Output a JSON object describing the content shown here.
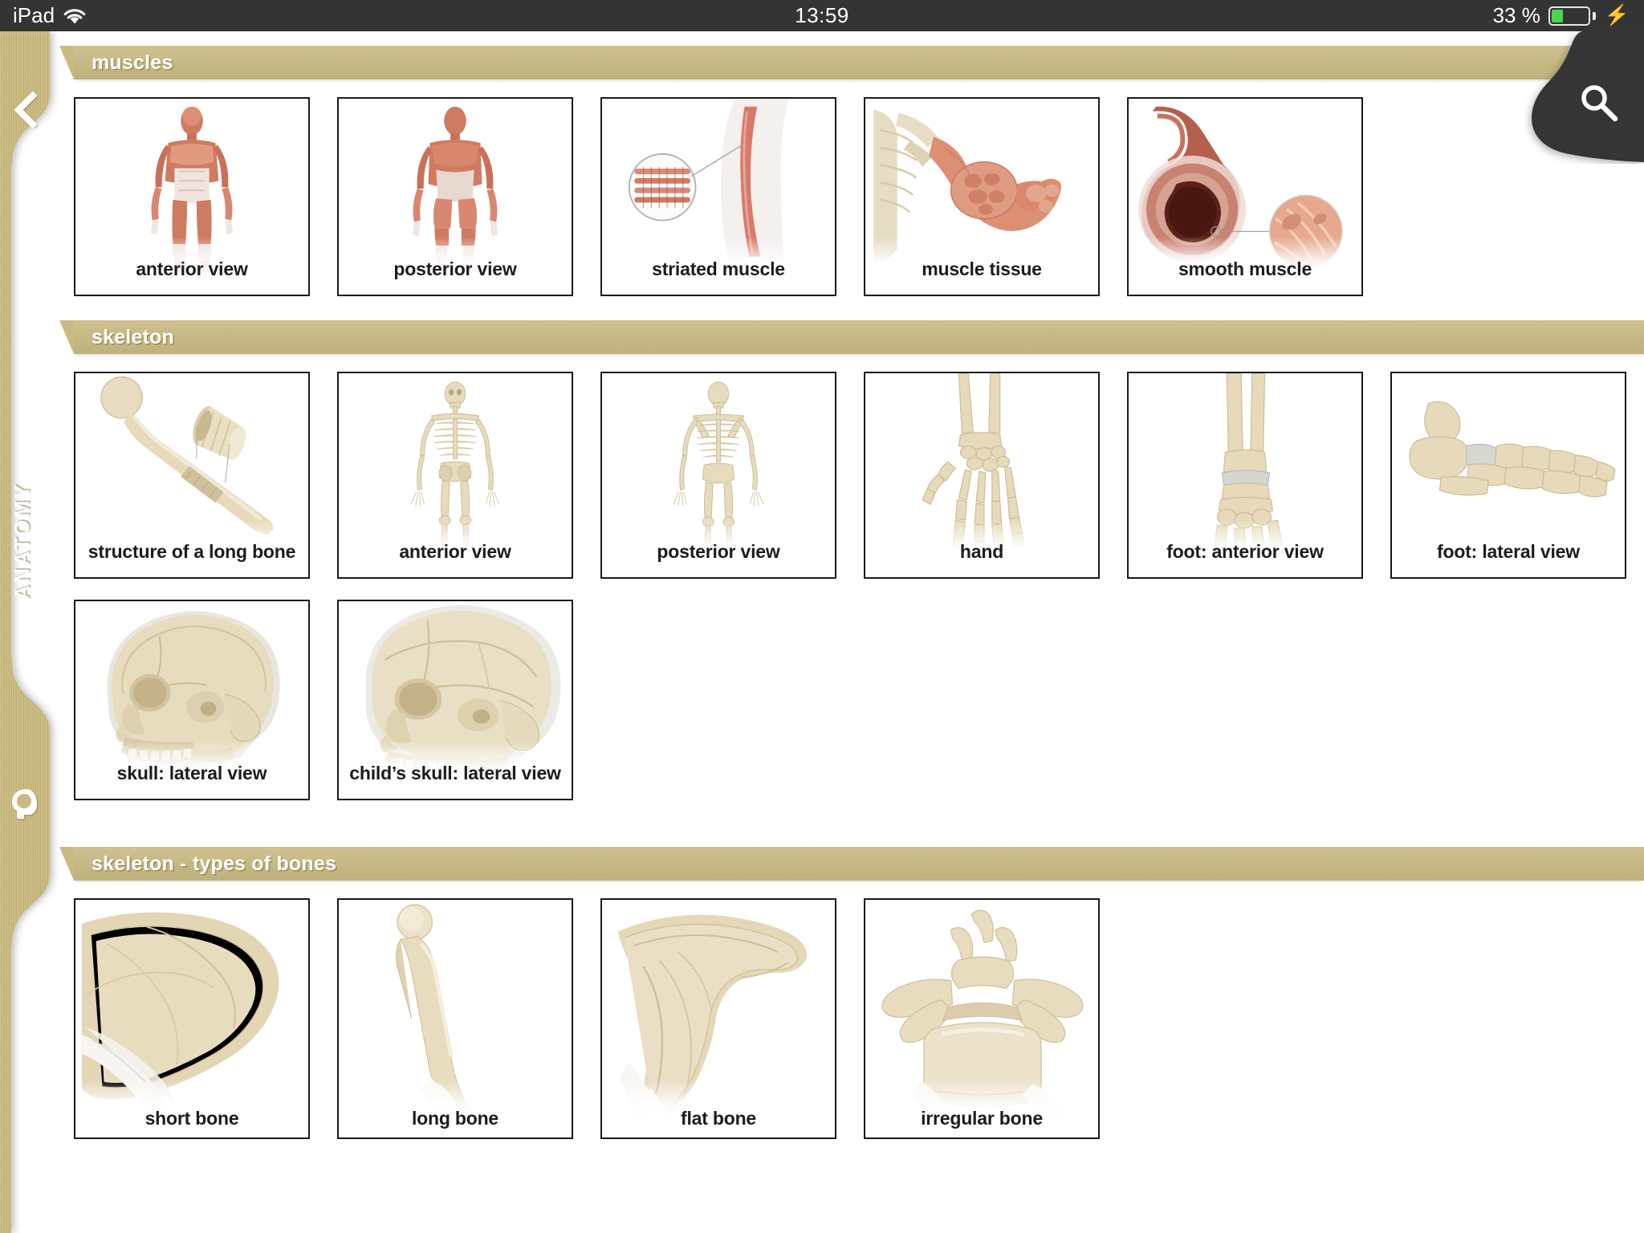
{
  "status_bar": {
    "device": "iPad",
    "wifi_icon": "wifi-icon",
    "time": "13:59",
    "battery_percent": "33 %",
    "battery_level": 33,
    "battery_color": "#4cd54c",
    "charging_icon": "lightning-bolt-icon"
  },
  "sidebar": {
    "title": "ANATOMY",
    "back_icon": "back-chevron-icon",
    "head_icon": "head-brain-icon",
    "color": "#c9ba81"
  },
  "search": {
    "icon": "search-icon",
    "tab_color": "#343434"
  },
  "theme": {
    "band_color": "#c9ba81",
    "card_border": "#1a1a1a",
    "label_color": "#1c1c1c",
    "page_background": "#ffffff"
  },
  "sections": [
    {
      "id": "muscles",
      "title": "muscles",
      "cards": [
        {
          "label": "anterior view",
          "art": "muscular-system-anterior"
        },
        {
          "label": "posterior view",
          "art": "muscular-system-posterior"
        },
        {
          "label": "striated muscle",
          "art": "striated-muscle"
        },
        {
          "label": "muscle tissue",
          "art": "muscle-tissue"
        },
        {
          "label": "smooth muscle",
          "art": "smooth-muscle"
        }
      ]
    },
    {
      "id": "skeleton",
      "title": "skeleton",
      "cards": [
        {
          "label": "structure of a long bone",
          "art": "long-bone-structure"
        },
        {
          "label": "anterior view",
          "art": "skeleton-anterior"
        },
        {
          "label": "posterior view",
          "art": "skeleton-posterior"
        },
        {
          "label": "hand",
          "art": "hand-bones"
        },
        {
          "label": "foot: anterior view",
          "art": "foot-anterior"
        },
        {
          "label": "foot: lateral view",
          "art": "foot-lateral"
        },
        {
          "label": "skull: lateral view",
          "art": "skull-lateral"
        },
        {
          "label": "child’s skull: lateral view",
          "art": "child-skull-lateral"
        }
      ]
    },
    {
      "id": "skeleton-types-of-bones",
      "title": "skeleton - types of bones",
      "cards": [
        {
          "label": "short bone",
          "art": "short-bone"
        },
        {
          "label": "long bone",
          "art": "long-bone"
        },
        {
          "label": "flat bone",
          "art": "flat-bone"
        },
        {
          "label": "irregular bone",
          "art": "irregular-bone"
        }
      ]
    }
  ]
}
